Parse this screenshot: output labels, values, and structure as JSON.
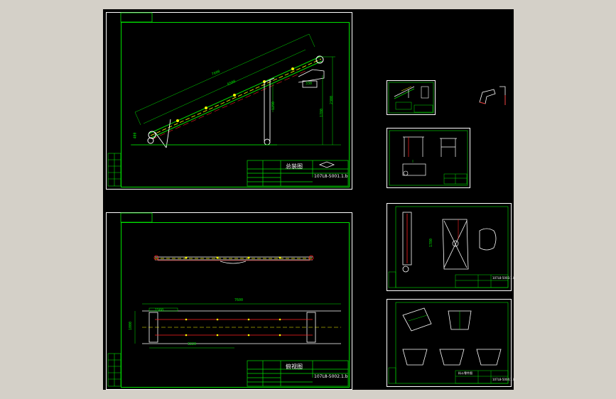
{
  "sheets": {
    "general_assembly": {
      "title": "总装图",
      "drawing_number": "107L8-5001.1.b"
    },
    "top_view": {
      "title": "俯视图",
      "drawing_number": "107L8-5002.1.b"
    },
    "frame": {
      "drawing_number": "107L8-5003.1.b"
    },
    "hopper": {
      "title": "料斗零件图",
      "drawing_number": "107L8-5004.1.b"
    }
  },
  "dimensions": {
    "overall_length": "7600",
    "belt_length": "6500",
    "height_1": "2300",
    "height_2": "1780",
    "width_1": "1290",
    "width_2": "1000",
    "span": "3220",
    "bottom_span": "1560",
    "base_height": "400",
    "width_3": "330"
  },
  "colors": {
    "background": "#000000",
    "frame": "#00e000",
    "sheet": "#ffffff",
    "part": "#ff2020",
    "accent": "#ffff00"
  }
}
